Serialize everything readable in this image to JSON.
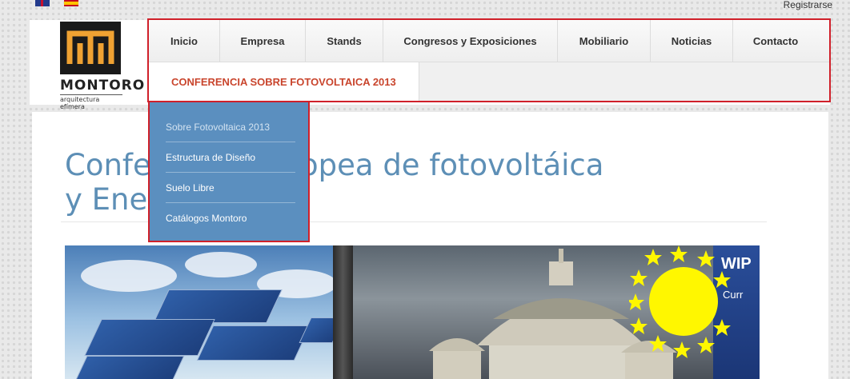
{
  "top": {
    "register": "Registrarse"
  },
  "logo": {
    "name": "MONTORO",
    "tagline": "arquitectura efímera"
  },
  "nav": {
    "items": [
      {
        "label": "Inicio"
      },
      {
        "label": "Empresa"
      },
      {
        "label": "Stands"
      },
      {
        "label": "Congresos y Exposiciones"
      },
      {
        "label": "Mobiliario"
      },
      {
        "label": "Noticias"
      },
      {
        "label": "Contacto"
      }
    ],
    "active": "CONFERENCIA SOBRE FOTOVOLTAICA 2013"
  },
  "dropdown": {
    "items": [
      {
        "label": "Sobre Fotovoltaica 2013"
      },
      {
        "label": "Estructura de Diseño"
      },
      {
        "label": "Suelo Libre"
      },
      {
        "label": "Catálogos Montoro"
      }
    ]
  },
  "page": {
    "title_line1": "Conferencia europea de fotovoltáica",
    "title_line2": "y Energía"
  },
  "photo": {
    "banner_text": "WIP",
    "banner_sub": "Curr"
  },
  "colors": {
    "accent": "#5b8fbf",
    "active_nav": "#c9452d",
    "highlight_border": "#d0202a",
    "title": "#5d8fb6"
  }
}
